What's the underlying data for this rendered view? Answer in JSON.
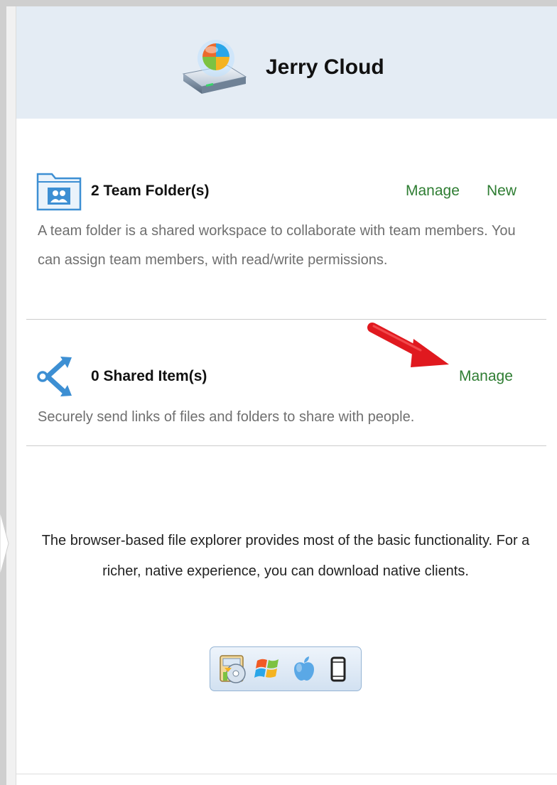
{
  "header": {
    "title": "Jerry Cloud",
    "icon": "cloud-drive-icon"
  },
  "team_folders": {
    "icon": "team-folder-icon",
    "title": "2 Team Folder(s)",
    "manage_label": "Manage",
    "new_label": "New",
    "description": "A team folder is a shared workspace to collaborate with team members. You can assign team members, with read/write permissions."
  },
  "shared_items": {
    "icon": "share-icon",
    "title": "0 Shared Item(s)",
    "manage_label": "Manage",
    "description": "Securely send links of files and folders to share with people."
  },
  "annotation": {
    "icon": "red-arrow-icon",
    "color": "#e0191f"
  },
  "clients": {
    "description": "The browser-based file explorer provides most of the basic functionality. For a richer, native experience, you can download native clients.",
    "icons": [
      "drive-client-icon",
      "windows-icon",
      "apple-icon",
      "mobile-icon"
    ]
  },
  "colors": {
    "link": "#2e7d32",
    "header_bg": "#e4ecf4",
    "accent_blue": "#3d8fd3"
  }
}
